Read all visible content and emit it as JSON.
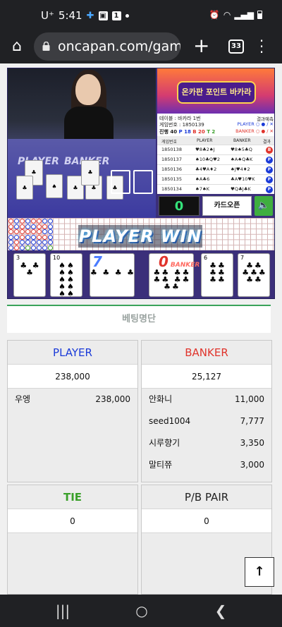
{
  "status": {
    "carrier": "U⁺",
    "time": "5:41",
    "notif_count": "1"
  },
  "browser": {
    "url": "oncapan.com/gamezo",
    "tab_count": "33"
  },
  "game": {
    "video_labels": {
      "player": "PLAYER",
      "banker": "BANKER"
    },
    "banner_text": "온카판 포인트 바카라",
    "info": {
      "table": "테이블 : 바카라 1번",
      "result_btn": "결과예측",
      "game_no": "게임번호 : 1850139",
      "progress": "진행 40",
      "p_count": "P 18",
      "b_count": "B 20",
      "t_count": "T 2",
      "legend_player": "PLAYER",
      "legend_banker": "BANKER"
    },
    "history_headers": [
      "게임번호",
      "PLAYER",
      "BANKER",
      "결과"
    ],
    "history": [
      {
        "no": "1850138",
        "player": "♥8♣2♠J",
        "banker": "♥8♠5♣Q",
        "result": "B"
      },
      {
        "no": "1850137",
        "player": "♠10♣Q♥2",
        "banker": "♠A♠Q♣K",
        "result": "P"
      },
      {
        "no": "1850136",
        "player": "♣4♥A♦2",
        "banker": "♠J♥4♦2",
        "result": "P"
      },
      {
        "no": "1850135",
        "player": "♠A♣6",
        "banker": "♣A♥10♥K",
        "result": "P"
      },
      {
        "no": "1850134",
        "player": "♠7♠K",
        "banker": "♥Q♣J♣K",
        "result": "P"
      }
    ],
    "countdown": "0",
    "card_open": "카드오픈",
    "winner_text": "PLAYER WIN",
    "player_score": "7",
    "player_label": "PLAYER",
    "banker_score": "0",
    "banker_label": "BANKER",
    "cards": [
      {
        "rank": "3",
        "pips": "♣ ♣ ♣"
      },
      {
        "rank": "10",
        "pips": "♠♠ ♠♠ ♠♠ ♠♠ ♠♠"
      },
      {
        "rank": "4",
        "pips": "♣ ♣ ♣ ♣"
      },
      {
        "rank": "10",
        "pips": "♣♣ ♣♣ ♣♣ ♣♣ ♣♣"
      },
      {
        "rank": "6",
        "pips": "♣♣ ♣♣ ♣♣"
      },
      {
        "rank": "7",
        "pips": "♣♣ ♣♣♣ ♣♣"
      }
    ],
    "colors": {
      "player": "#1a3ad8",
      "banker": "#e0342c",
      "tie": "#3aa02a"
    }
  },
  "betting": {
    "title": "베팅명단",
    "player": {
      "label": "PLAYER",
      "total": "238,000",
      "entries": [
        {
          "name": "우엥",
          "amount": "238,000"
        }
      ]
    },
    "banker": {
      "label": "BANKER",
      "total": "25,127",
      "entries": [
        {
          "name": "안화니",
          "amount": "11,000"
        },
        {
          "name": "seed1004",
          "amount": "7,777"
        },
        {
          "name": "시루향기",
          "amount": "3,350"
        },
        {
          "name": "말티쮸",
          "amount": "3,000"
        }
      ]
    },
    "tie": {
      "label": "TIE",
      "total": "0"
    },
    "pair": {
      "label": "P/B PAIR",
      "total": "0"
    }
  },
  "scroll_top": "↑"
}
